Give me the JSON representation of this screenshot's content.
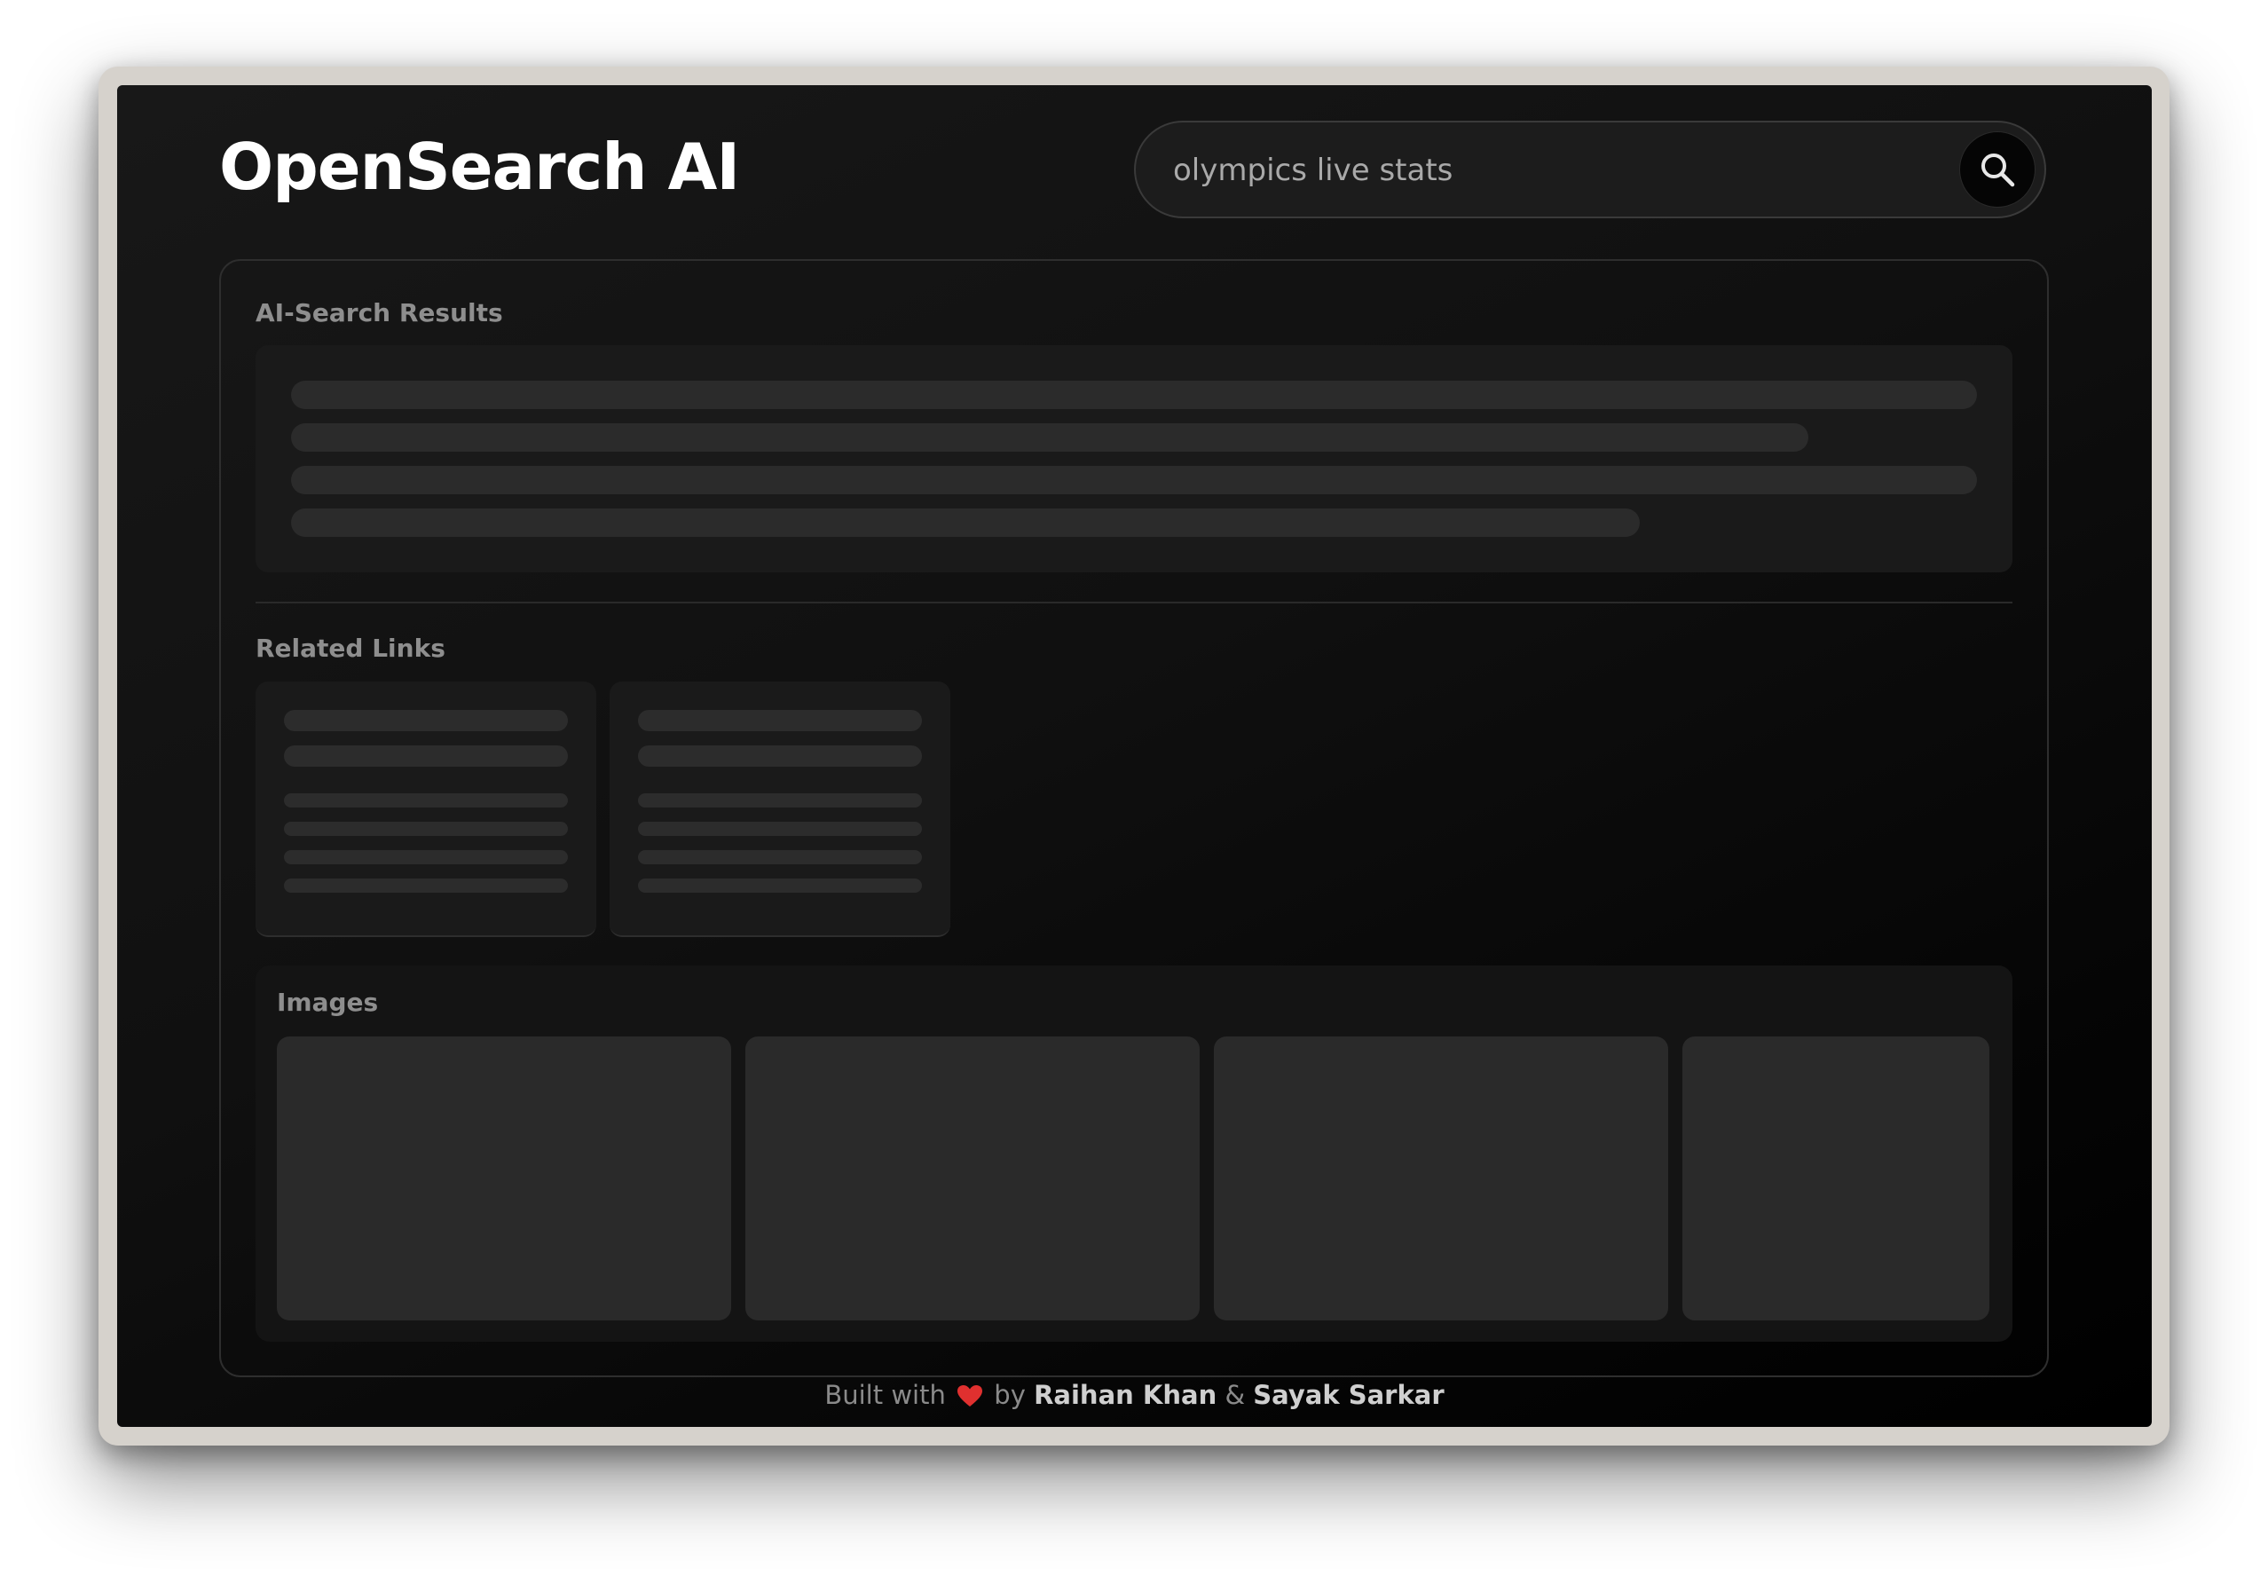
{
  "app": {
    "brand": "OpenSearch AI"
  },
  "search": {
    "query": "olympics live stats",
    "button_icon": "search-icon"
  },
  "sections": {
    "ai_results_title": "AI-Search Results",
    "related_links_title": "Related Links",
    "images_title": "Images"
  },
  "footer": {
    "prefix": "Built with",
    "heart_icon": "heart-icon",
    "by": "by",
    "author1": "Raihan Khan",
    "amp": "&",
    "author2": "Sayak Sarkar"
  },
  "colors": {
    "background": "#101010",
    "skeleton": "#2b2b2b",
    "heart": "#e0302f"
  }
}
